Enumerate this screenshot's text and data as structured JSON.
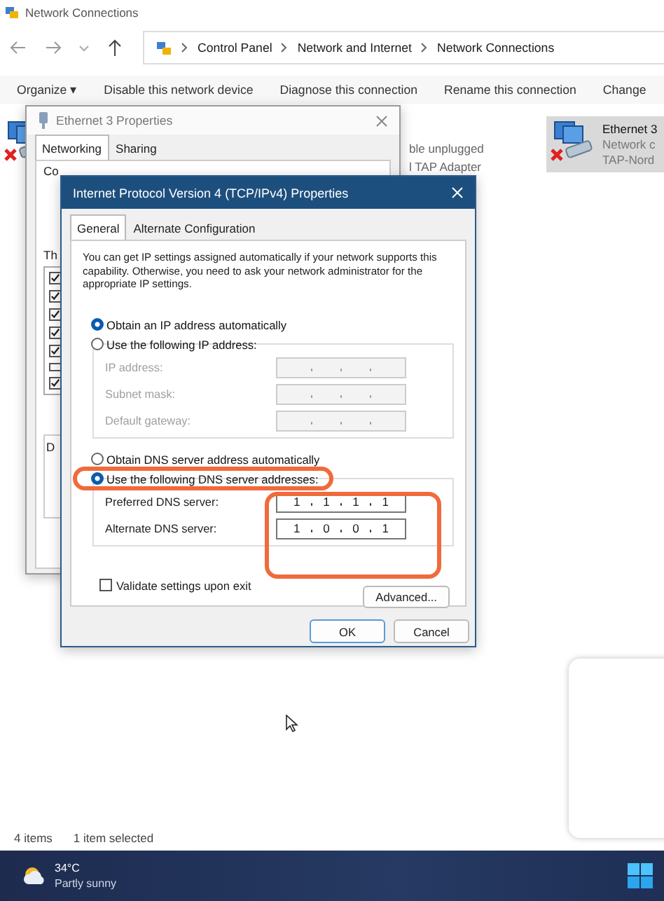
{
  "explorer": {
    "title": "Network Connections",
    "breadcrumb": [
      "Control Panel",
      "Network and Internet",
      "Network Connections"
    ],
    "commands": [
      "Organize ▾",
      "Disable this network device",
      "Diagnose this connection",
      "Rename this connection",
      "Change"
    ],
    "items": [
      {
        "selected": false,
        "lines": [
          "ble unplugged",
          "l TAP Adapter"
        ]
      },
      {
        "selected": true,
        "lines": [
          "Ethernet 3",
          "Network c",
          "TAP-Nord"
        ]
      }
    ],
    "status": [
      "4 items",
      "1 item selected"
    ]
  },
  "ethernet_dialog": {
    "title": "Ethernet 3 Properties",
    "tabs": [
      {
        "label": "Networking",
        "selected": true
      },
      {
        "label": "Sharing",
        "selected": false
      }
    ],
    "fragments": [
      "Co",
      "Th",
      "D"
    ],
    "components": [
      {
        "checked": true
      },
      {
        "checked": true
      },
      {
        "checked": true
      },
      {
        "checked": true
      },
      {
        "checked": true
      },
      {
        "checked": false
      },
      {
        "checked": true
      }
    ]
  },
  "ipv4_dialog": {
    "title": "Internet Protocol Version 4 (TCP/IPv4) Properties",
    "tabs": [
      {
        "label": "General",
        "selected": true
      },
      {
        "label": "Alternate Configuration",
        "selected": false
      }
    ],
    "intro": "You can get IP settings assigned automatically if your network supports this capability. Otherwise, you need to ask your network administrator for the appropriate IP settings.",
    "ip_mode": [
      {
        "label": "Obtain an IP address automatically",
        "selected": true
      },
      {
        "label": "Use the following IP address:",
        "selected": false
      }
    ],
    "ip_fields": [
      {
        "label": "IP address:",
        "disabled": true
      },
      {
        "label": "Subnet mask:",
        "disabled": true
      },
      {
        "label": "Default gateway:",
        "disabled": true
      }
    ],
    "dns_mode": [
      {
        "label": "Obtain DNS server address automatically",
        "selected": false
      },
      {
        "label": "Use the following DNS server addresses:",
        "selected": true
      }
    ],
    "dns_fields": [
      {
        "label": "Preferred DNS server:",
        "disabled": false,
        "octets": [
          "1",
          "1",
          "1",
          "1"
        ]
      },
      {
        "label": "Alternate DNS server:",
        "disabled": false,
        "octets": [
          "1",
          "0",
          "0",
          "1"
        ]
      }
    ],
    "validate": {
      "label": "Validate settings upon exit",
      "checked": false
    },
    "advanced": "Advanced...",
    "ok": "OK",
    "cancel": "Cancel"
  },
  "taskbar": {
    "temperature": "34°C",
    "weather": "Partly sunny"
  }
}
